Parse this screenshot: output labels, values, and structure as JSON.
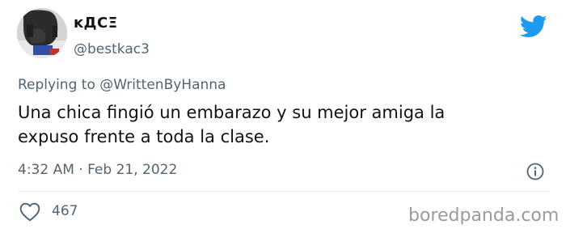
{
  "author": {
    "display_name": "ĸДСΞ",
    "handle": "@bestkac3"
  },
  "reply": {
    "prefix": "Replying to",
    "mention": "@WrittenByHanna"
  },
  "tweet": {
    "text_line1": "Una chica fingió un embarazo y su mejor amiga la",
    "text_line2": "expuso frente a toda la clase.",
    "timestamp": "4:32 AM · Feb 21, 2022"
  },
  "actions": {
    "like_count": "467"
  },
  "watermark": "boredpanda.com",
  "colors": {
    "twitter_blue": "#1d9bf0",
    "secondary_text": "#536471",
    "primary_text": "#0f1419",
    "watermark": "#9b9b9b"
  },
  "icons": {
    "brand": "twitter-bird-icon",
    "info": "info-icon",
    "like": "heart-icon"
  }
}
